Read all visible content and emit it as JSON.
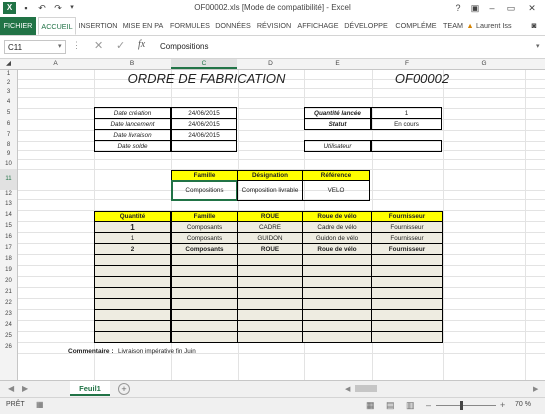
{
  "window": {
    "title": "OF00002.xls  [Mode de compatibilité] - Excel",
    "help": "?"
  },
  "ribbon": {
    "tabs": [
      "FICHIER",
      "ACCUEIL",
      "INSERTION",
      "MISE EN PA",
      "FORMULES",
      "DONNÉES",
      "RÉVISION",
      "AFFICHAGE",
      "DÉVELOPPE",
      "COMPLÉME",
      "TEAM"
    ],
    "user": "Laurent Iss"
  },
  "formula_bar": {
    "name_box": "C11",
    "fx": "fx",
    "content": "Compositions"
  },
  "grid": {
    "columns": [
      "A",
      "B",
      "C",
      "D",
      "E",
      "F",
      "G"
    ],
    "selected_column": "C",
    "rows": [
      "1",
      "2",
      "3",
      "4",
      "5",
      "6",
      "7",
      "8",
      "9",
      "10",
      "11",
      "12",
      "13",
      "14",
      "15",
      "16",
      "17",
      "18",
      "19",
      "20",
      "21",
      "22",
      "23",
      "24",
      "25",
      "26"
    ],
    "selected_row": "11"
  },
  "document": {
    "title": "ORDRE DE FABRICATION",
    "of_number": "OF00002",
    "dates": [
      {
        "label": "Date création",
        "value": "24/06/2015"
      },
      {
        "label": "Date lancement",
        "value": "24/06/2015"
      },
      {
        "label": "Date livraison",
        "value": "24/06/2015"
      },
      {
        "label": "Date solde",
        "value": ""
      }
    ],
    "info": [
      {
        "label": "Quantité lancée",
        "value": "1"
      },
      {
        "label": "Statut",
        "value": "En cours"
      }
    ],
    "user_label": "Utilisateur",
    "user_value": "",
    "product_headers": [
      "Famille",
      "Désignation",
      "Référence"
    ],
    "product_row": [
      "Compositions",
      "Composition livrable",
      "VELO"
    ],
    "lines_headers": [
      "Quantité",
      "Famille",
      "ROUE",
      "Roue de vélo",
      "Fournisseur"
    ],
    "lines": [
      [
        "1",
        "Composants",
        "CADRE",
        "Cadre de vélo",
        "Fournisseur"
      ],
      [
        "1",
        "Composants",
        "GUIDON",
        "Guidon de vélo",
        "Fournisseur"
      ],
      [
        "2",
        "Composants",
        "ROUE",
        "Roue de vélo",
        "Fournisseur"
      ]
    ],
    "comment_label": "Commentaire :",
    "comment_value": "Livraison impérative fin Juin"
  },
  "sheet_tabs": {
    "active": "Feuil1"
  },
  "status": {
    "mode": "PRÊT",
    "zoom": "70 %"
  }
}
